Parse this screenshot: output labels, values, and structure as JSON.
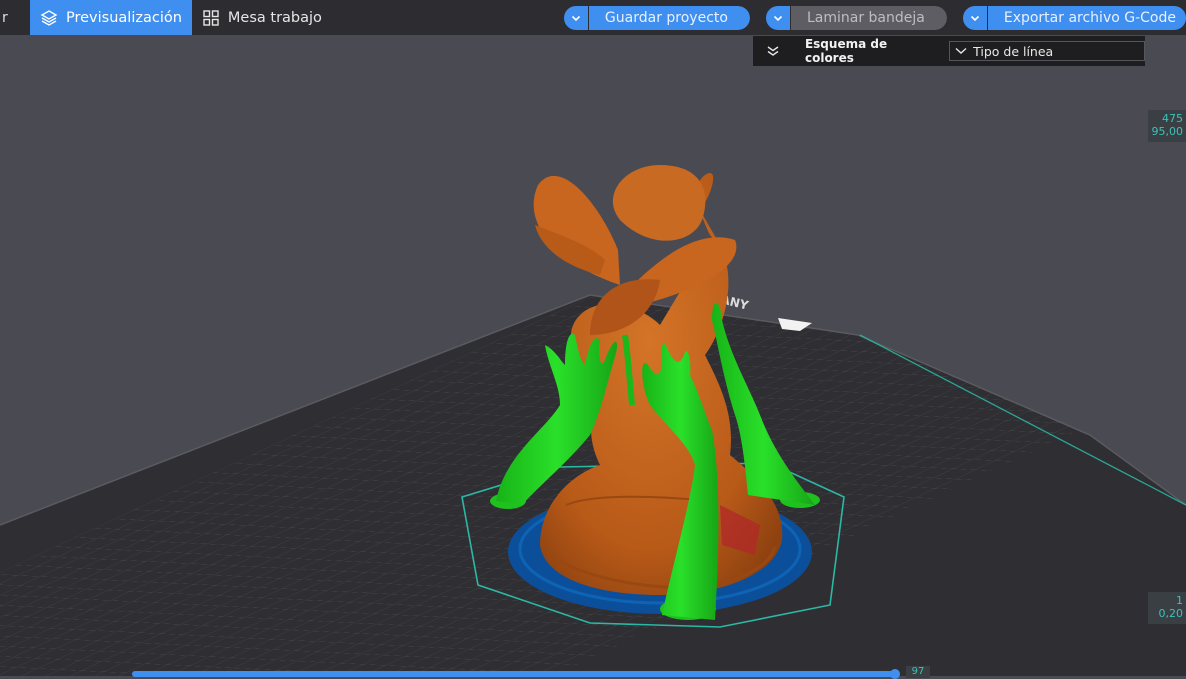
{
  "toolbar": {
    "prev_tab_stub": "r",
    "tab_preview": "Previsualización",
    "tab_workbench": "Mesa trabajo",
    "save_project": "Guardar proyecto",
    "slice_plate": "Laminar bandeja",
    "export_gcode": "Exportar archivo G-Code"
  },
  "color_scheme": {
    "title": "Esquema de colores",
    "selected": "Tipo de línea"
  },
  "layer_slider": {
    "top_layer": "475",
    "top_height": "95,00",
    "bottom_layer": "1",
    "bottom_height": "0,20"
  },
  "move_slider": {
    "value": "97"
  },
  "colors": {
    "accent": "#3f8ff0",
    "model_outer_wall": "#c8651e",
    "support": "#1fd11f",
    "skirt": "#2bb8a5",
    "brim": "#0b4f9a",
    "plate": "#2f2f33"
  },
  "icons": {
    "preview": "layers-icon",
    "workbench": "grid-icon",
    "dropdown": "chevron-down-icon",
    "collapse": "double-chevron-icon"
  }
}
